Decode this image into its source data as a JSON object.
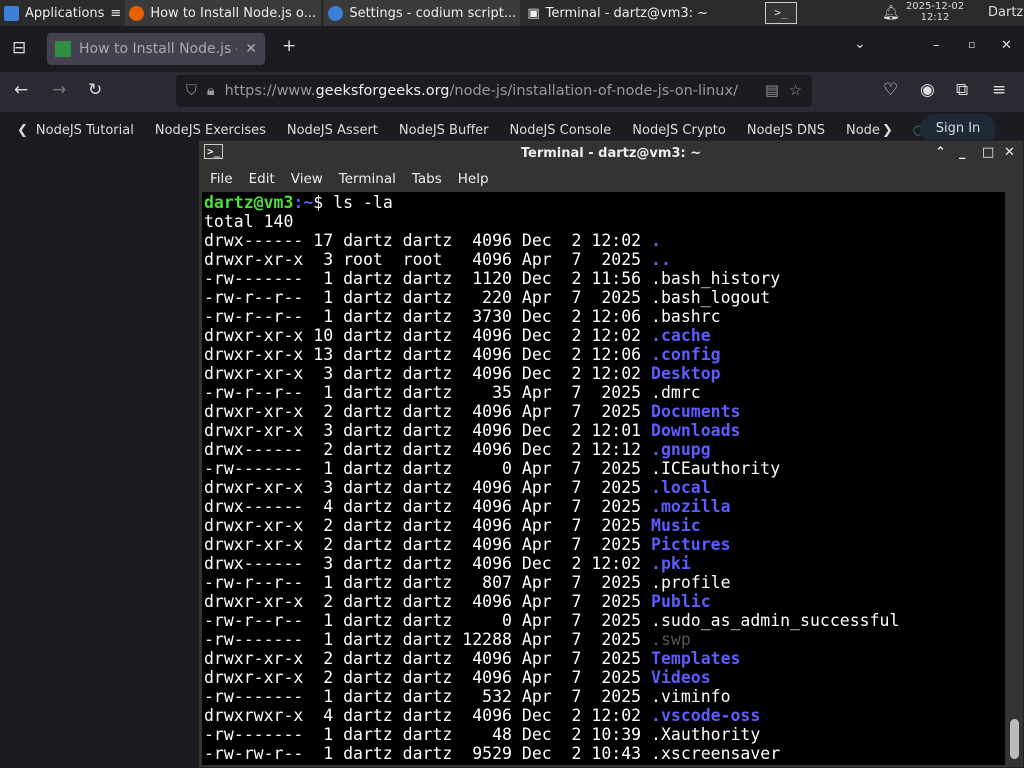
{
  "taskbar": {
    "apps": "Applications",
    "tasks": [
      "How to Install Node.js o...",
      "Settings - codium script...",
      "Terminal - dartz@vm3: ~"
    ],
    "date": "2025-12-02",
    "time": "12:12",
    "user": "Dartz"
  },
  "browser": {
    "tab_title": "How to Install Node.js on",
    "url_prefix": "https://www.",
    "url_domain": "geeksforgeeks.org",
    "url_path": "/node-js/installation-of-node-js-on-linux/",
    "site_nav": [
      "NodeJS Tutorial",
      "NodeJS Exercises",
      "NodeJS Assert",
      "NodeJS Buffer",
      "NodeJS Console",
      "NodeJS Crypto",
      "NodeJS DNS",
      "Node"
    ],
    "sign_in": "Sign In"
  },
  "terminal": {
    "title": "Terminal - dartz@vm3: ~",
    "menu": [
      "File",
      "Edit",
      "View",
      "Terminal",
      "Tabs",
      "Help"
    ],
    "prompt_user": "dartz@vm3",
    "prompt_path": ":~",
    "prompt_sym": "$ ",
    "command": "ls -la",
    "total": "total 140",
    "rows": [
      [
        "drwx------ 17 dartz dartz  4096 Dec  2 12:02 ",
        ".",
        "dir"
      ],
      [
        "drwxr-xr-x  3 root  root   4096 Apr  7  2025 ",
        "..",
        "dir"
      ],
      [
        "-rw-------  1 dartz dartz  1120 Dec  2 11:56 ",
        ".bash_history",
        "file"
      ],
      [
        "-rw-r--r--  1 dartz dartz   220 Apr  7  2025 ",
        ".bash_logout",
        "file"
      ],
      [
        "-rw-r--r--  1 dartz dartz  3730 Dec  2 12:06 ",
        ".bashrc",
        "file"
      ],
      [
        "drwxr-xr-x 10 dartz dartz  4096 Dec  2 12:02 ",
        ".cache",
        "dir"
      ],
      [
        "drwxr-xr-x 13 dartz dartz  4096 Dec  2 12:06 ",
        ".config",
        "dir"
      ],
      [
        "drwxr-xr-x  3 dartz dartz  4096 Dec  2 12:02 ",
        "Desktop",
        "dir"
      ],
      [
        "-rw-r--r--  1 dartz dartz    35 Apr  7  2025 ",
        ".dmrc",
        "file"
      ],
      [
        "drwxr-xr-x  2 dartz dartz  4096 Apr  7  2025 ",
        "Documents",
        "dir"
      ],
      [
        "drwxr-xr-x  3 dartz dartz  4096 Dec  2 12:01 ",
        "Downloads",
        "dir"
      ],
      [
        "drwx------  2 dartz dartz  4096 Dec  2 12:12 ",
        ".gnupg",
        "dir"
      ],
      [
        "-rw-------  1 dartz dartz     0 Apr  7  2025 ",
        ".ICEauthority",
        "file"
      ],
      [
        "drwxr-xr-x  3 dartz dartz  4096 Apr  7  2025 ",
        ".local",
        "dir"
      ],
      [
        "drwx------  4 dartz dartz  4096 Apr  7  2025 ",
        ".mozilla",
        "dir"
      ],
      [
        "drwxr-xr-x  2 dartz dartz  4096 Apr  7  2025 ",
        "Music",
        "dir"
      ],
      [
        "drwxr-xr-x  2 dartz dartz  4096 Apr  7  2025 ",
        "Pictures",
        "dir"
      ],
      [
        "drwx------  3 dartz dartz  4096 Dec  2 12:02 ",
        ".pki",
        "dir"
      ],
      [
        "-rw-r--r--  1 dartz dartz   807 Apr  7  2025 ",
        ".profile",
        "file"
      ],
      [
        "drwxr-xr-x  2 dartz dartz  4096 Apr  7  2025 ",
        "Public",
        "dir"
      ],
      [
        "-rw-r--r--  1 dartz dartz     0 Apr  7  2025 ",
        ".sudo_as_admin_successful",
        "file"
      ],
      [
        "-rw-------  1 dartz dartz 12288 Apr  7  2025 ",
        ".swp",
        "gray"
      ],
      [
        "drwxr-xr-x  2 dartz dartz  4096 Apr  7  2025 ",
        "Templates",
        "dir"
      ],
      [
        "drwxr-xr-x  2 dartz dartz  4096 Apr  7  2025 ",
        "Videos",
        "dir"
      ],
      [
        "-rw-------  1 dartz dartz   532 Apr  7  2025 ",
        ".viminfo",
        "file"
      ],
      [
        "drwxrwxr-x  4 dartz dartz  4096 Dec  2 12:02 ",
        ".vscode-oss",
        "dir"
      ],
      [
        "-rw-------  1 dartz dartz    48 Dec  2 10:39 ",
        ".Xauthority",
        "file"
      ],
      [
        "-rw-rw-r--  1 dartz dartz  9529 Dec  2 10:43 ",
        ".xscreensaver",
        "file"
      ]
    ]
  },
  "colors": {
    "dir": "#5c5cff",
    "prompt_user": "#4ddf3a",
    "terminal_bg": "#000000"
  }
}
